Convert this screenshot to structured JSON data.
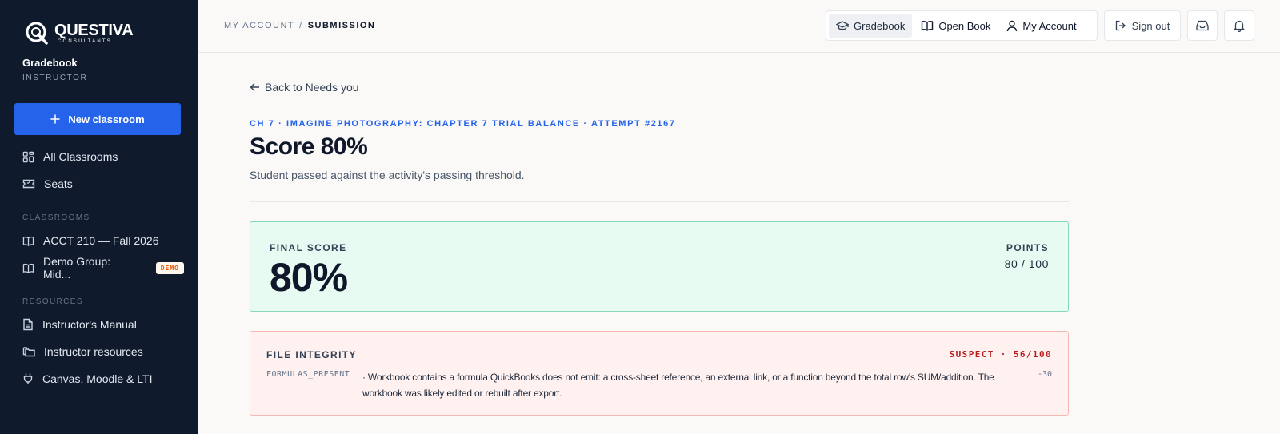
{
  "brand": {
    "name": "QUESTIVA",
    "tagline": "CONSULTANTS"
  },
  "sidebar": {
    "title": "Gradebook",
    "role": "INSTRUCTOR",
    "new_button": "New classroom",
    "main_items": [
      {
        "label": "All Classrooms",
        "icon": "grid-icon"
      },
      {
        "label": "Seats",
        "icon": "ticket-icon"
      }
    ],
    "classrooms_label": "CLASSROOMS",
    "classrooms": [
      {
        "label": "ACCT 210 — Fall 2026",
        "icon": "book-icon"
      },
      {
        "label": "Demo Group: Mid...",
        "icon": "book-icon",
        "badge": "DEMO"
      }
    ],
    "resources_label": "RESOURCES",
    "resources": [
      {
        "label": "Instructor's Manual",
        "icon": "document-icon"
      },
      {
        "label": "Instructor resources",
        "icon": "folders-icon"
      },
      {
        "label": "Canvas, Moodle & LTI",
        "icon": "plug-icon"
      }
    ]
  },
  "topbar": {
    "breadcrumb": [
      "MY ACCOUNT",
      "SUBMISSION"
    ],
    "separator": "/",
    "tabs": [
      {
        "label": "Gradebook",
        "icon": "graduation-cap-icon",
        "active": true
      },
      {
        "label": "Open Book",
        "icon": "open-book-icon",
        "active": false
      },
      {
        "label": "My Account",
        "icon": "user-icon",
        "active": false
      }
    ],
    "sign_out": "Sign out"
  },
  "main": {
    "back_link": "Back to Needs you",
    "kicker": "CH 7 · IMAGINE PHOTOGRAPHY: CHAPTER 7 TRIAL BALANCE · ATTEMPT #2167",
    "title": "Score 80%",
    "description": "Student passed against the activity's passing threshold.",
    "final_score": {
      "label": "FINAL SCORE",
      "value": "80%",
      "points_label": "POINTS",
      "points_value": "80 / 100"
    },
    "integrity": {
      "label": "FILE INTEGRITY",
      "status": "SUSPECT · 56/100",
      "code": "FORMULAS_PRESENT",
      "text": "· Workbook contains a formula QuickBooks does not emit: a cross-sheet reference, an external link, or a function beyond the total row's SUM/addition. The workbook was likely edited or rebuilt after export.",
      "penalty": "-30"
    }
  },
  "colors": {
    "sidebar_bg": "#0f1b2d",
    "accent": "#2563eb",
    "success_bg": "#e8fbf3",
    "danger_bg": "#fef1f0",
    "danger_text": "#b91c1c"
  }
}
